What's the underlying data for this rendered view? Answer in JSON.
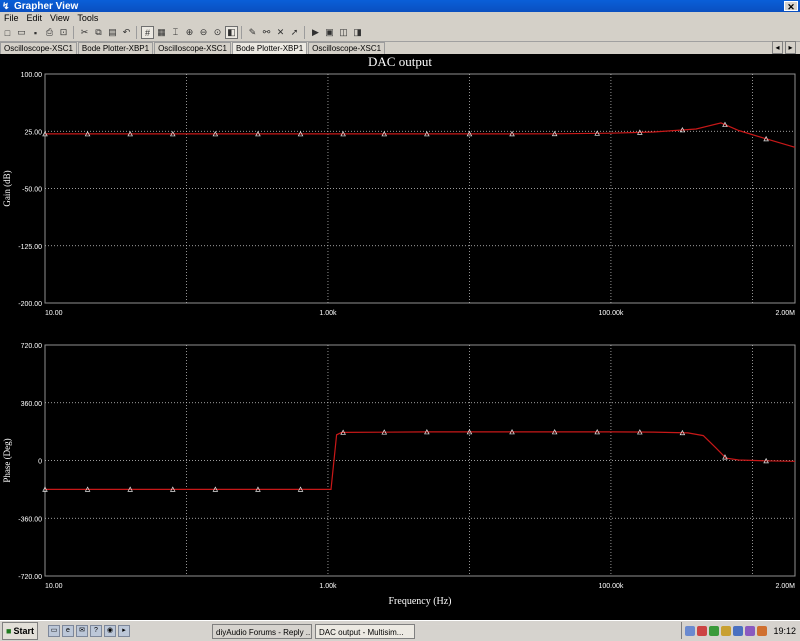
{
  "window": {
    "title": "Grapher View",
    "close_glyph": "✕"
  },
  "menu": [
    "File",
    "Edit",
    "View",
    "Tools"
  ],
  "tabs": [
    "Oscilloscope-XSC1",
    "Bode Plotter-XBP1",
    "Oscilloscope-XSC1",
    "Bode Plotter-XBP1",
    "Oscilloscope-XSC1"
  ],
  "active_tab": 3,
  "tab_nav": [
    "◂",
    "▸"
  ],
  "colors": {
    "background": "#000000",
    "trace": "#c81818",
    "marker": "#e6e6e6",
    "grid": "#d0d0d0",
    "text": "#ffffff"
  },
  "chart_data": {
    "type": "line",
    "title": "DAC output",
    "xlabel": "Frequency (Hz)",
    "x_scale": "log",
    "xlim": [
      10,
      2000000
    ],
    "x_ticks": [
      10,
      1000,
      100000,
      2000000
    ],
    "x_tick_labels": [
      "10.00",
      "1.00k",
      "100.00k",
      "2.00M"
    ],
    "grid": true,
    "panels": [
      {
        "name": "gain",
        "ylabel": "Gain (dB)",
        "ylim": [
          -200,
          100
        ],
        "y_ticks": [
          100,
          25,
          -50,
          -125,
          -200
        ],
        "y_tick_labels": [
          "100.00",
          "25.00",
          "-50.00",
          "-125.00",
          "-200.00"
        ],
        "x": [
          10,
          25,
          60,
          150,
          400,
          1000,
          3000,
          10000,
          40000,
          100000,
          200000,
          400000,
          600000,
          800000,
          1200000,
          2000000
        ],
        "y": [
          21.5,
          21.5,
          21.5,
          21.5,
          21.5,
          21.5,
          21.5,
          21.5,
          21.7,
          22.5,
          24,
          28,
          36,
          26,
          16,
          4
        ],
        "marker_x": [
          10,
          20,
          40,
          80,
          160,
          320,
          640,
          1280,
          2500,
          5000,
          10000,
          20000,
          40000,
          80000,
          160000,
          320000,
          640000,
          1250000
        ]
      },
      {
        "name": "phase",
        "ylabel": "Phase (Deg)",
        "ylim": [
          -720,
          720
        ],
        "y_ticks": [
          720,
          360,
          0,
          -360,
          -720
        ],
        "y_tick_labels": [
          "720.00",
          "360.00",
          "0",
          "-360.00",
          "-720.00"
        ],
        "x": [
          10,
          500,
          1050,
          1150,
          1250,
          5000,
          10000,
          100000,
          200000,
          350000,
          450000,
          550000,
          650000,
          800000,
          1200000,
          2000000
        ],
        "y": [
          -180,
          -180,
          -180,
          160,
          175,
          178,
          178,
          178,
          177,
          172,
          155,
          80,
          15,
          3,
          -2,
          -5
        ],
        "marker_x": [
          10,
          20,
          40,
          80,
          160,
          320,
          640,
          1280,
          2500,
          5000,
          10000,
          20000,
          40000,
          80000,
          160000,
          320000,
          640000,
          1250000
        ]
      }
    ]
  },
  "taskbar": {
    "start": "Start",
    "tasks": [
      "diyAudio Forums - Reply ...",
      "DAC output - Multisim..."
    ],
    "clock": "19:12"
  }
}
